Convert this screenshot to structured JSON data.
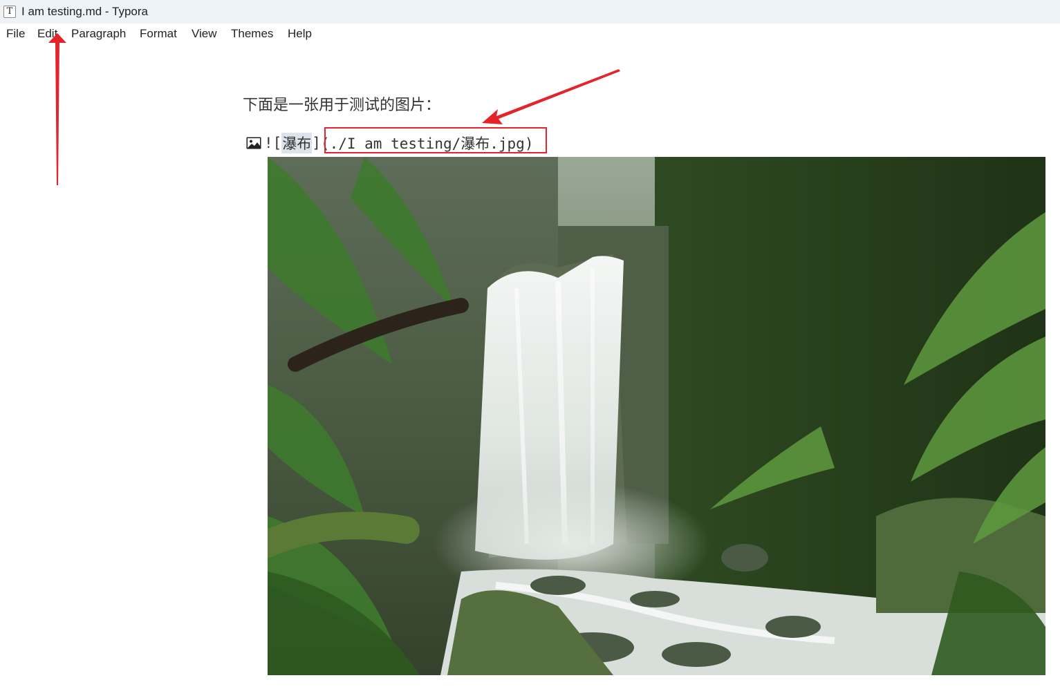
{
  "window": {
    "title": "I am testing.md - Typora",
    "app_icon_glyph": "T"
  },
  "menu": {
    "items": [
      "File",
      "Edit",
      "Paragraph",
      "Format",
      "View",
      "Themes",
      "Help"
    ]
  },
  "document": {
    "paragraph": "下面是一张用于测试的图片：",
    "image_markdown": {
      "prefix": "![",
      "alt": "瀑布",
      "middle": "]",
      "path": "(./I am testing/瀑布.jpg)"
    }
  },
  "colors": {
    "annotation": "#e3242b",
    "titlebar_bg": "#eef3f8",
    "alt_highlight": "#dde3ea"
  },
  "icons": [
    "image-icon",
    "app-icon"
  ]
}
